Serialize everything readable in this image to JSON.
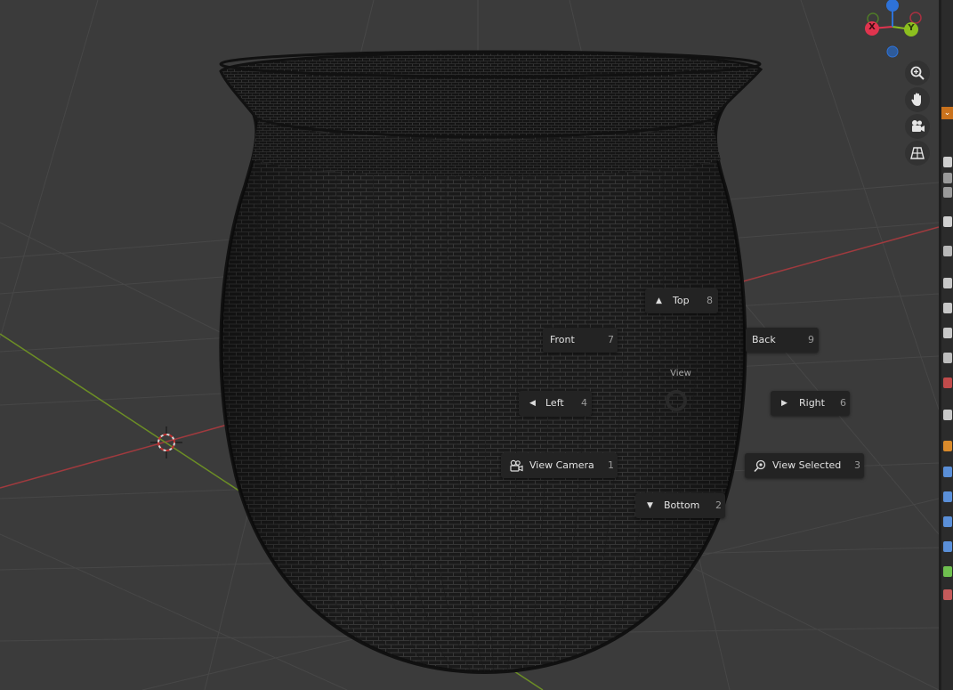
{
  "gizmo": {
    "x_label": "X",
    "y_label": "Y",
    "colors": {
      "x": "#e0344e",
      "y": "#8cbf1f",
      "z": "#2e72d8"
    }
  },
  "navigation": {
    "zoom": "zoom-icon",
    "pan": "hand-icon",
    "camera": "camera-icon",
    "perspective": "grid-icon"
  },
  "pie_menu": {
    "title": "View",
    "items": {
      "top": {
        "label": "Top",
        "key": "8"
      },
      "front": {
        "label": "Front",
        "key": "7"
      },
      "back": {
        "label": "Back",
        "key": "9"
      },
      "left": {
        "label": "Left",
        "key": "4"
      },
      "right": {
        "label": "Right",
        "key": "6"
      },
      "view_camera": {
        "label": "View Camera",
        "key": "1"
      },
      "view_selected": {
        "label": "View Selected",
        "key": "3"
      },
      "bottom": {
        "label": "Bottom",
        "key": "2"
      }
    }
  },
  "colors": {
    "background": "#3b3b3b",
    "x_axis": "#a03a3e",
    "y_axis": "#6c8e25",
    "menu_bg": "#232323",
    "accent_orange": "#c9721d"
  }
}
